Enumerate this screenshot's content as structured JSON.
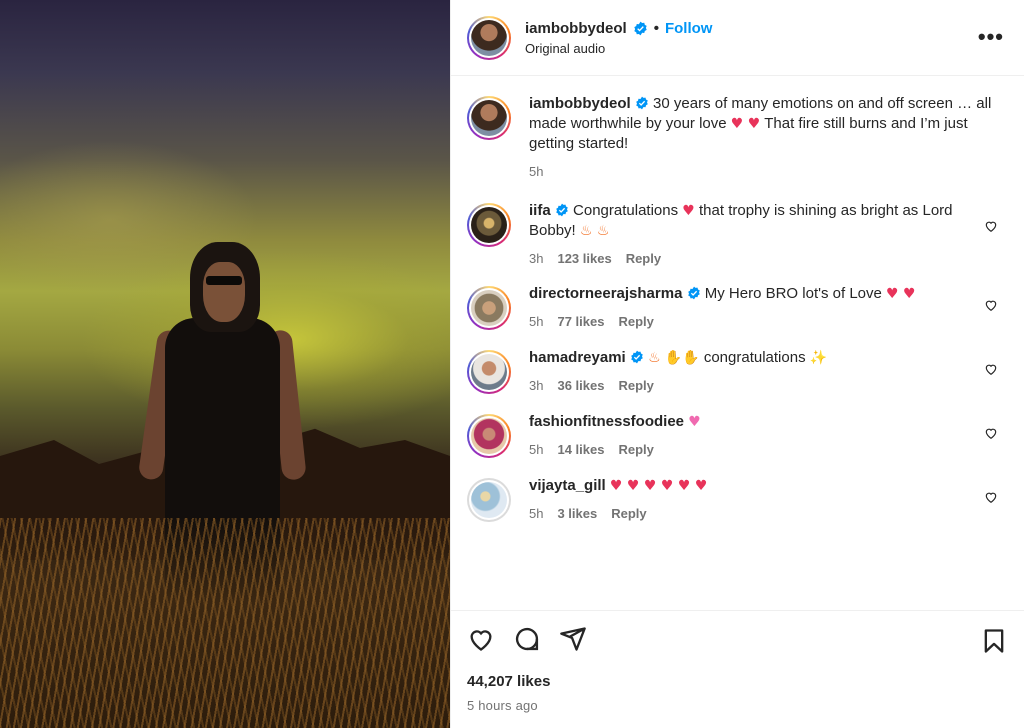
{
  "post": {
    "author": "iambobbydeol",
    "follow_label": "Follow",
    "dot": "•",
    "audio_label": "Original audio",
    "more_label": "•••",
    "caption_username": "iambobbydeol",
    "caption_text": "30 years of many emotions on and off screen … all made worthwhile by your love",
    "caption_text_2": "That fire still burns and I’m just getting started!",
    "caption_time": "5h",
    "likes": "44,207 likes",
    "posted_ago": "5 hours ago"
  },
  "comments": [
    {
      "username": "iifa",
      "verified": true,
      "text": "Congratulations",
      "text_2": "that trophy is shining as bright as Lord Bobby!",
      "time": "3h",
      "likes": "123 likes",
      "reply": "Reply"
    },
    {
      "username": "directorneerajsharma",
      "verified": true,
      "text": "My Hero BRO lot's of Love",
      "time": "5h",
      "likes": "77 likes",
      "reply": "Reply"
    },
    {
      "username": "hamadreyami",
      "verified": true,
      "text": "congratulations",
      "time": "3h",
      "likes": "36 likes",
      "reply": "Reply"
    },
    {
      "username": "fashionfitnessfoodiee",
      "verified": false,
      "text": "",
      "time": "5h",
      "likes": "14 likes",
      "reply": "Reply"
    },
    {
      "username": "vijayta_gill",
      "verified": false,
      "text": "",
      "time": "5h",
      "likes": "3 likes",
      "reply": "Reply"
    }
  ],
  "icons": {
    "like": "heart-icon",
    "comment": "comment-icon",
    "share": "share-icon",
    "save": "bookmark-icon",
    "verified": "verified-badge-icon",
    "more": "more-options-icon"
  },
  "colors": {
    "link": "#0095f6",
    "verified": "#0095f6",
    "muted": "#737373",
    "heart_emoji": "#e8335a"
  }
}
